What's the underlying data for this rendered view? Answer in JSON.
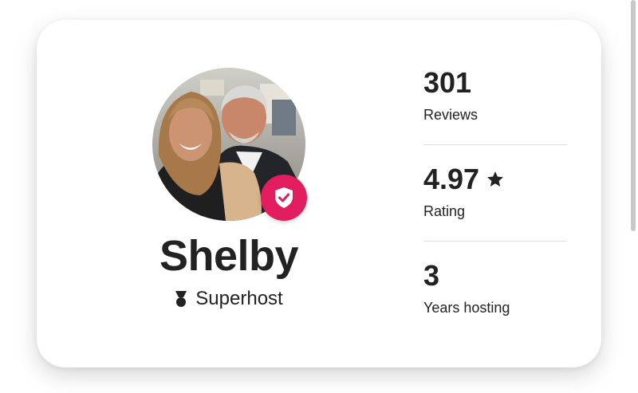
{
  "host": {
    "name": "Shelby",
    "badge_label": "Superhost"
  },
  "stats": {
    "reviews": {
      "value": "301",
      "label": "Reviews"
    },
    "rating": {
      "value": "4.97",
      "label": "Rating"
    },
    "years": {
      "value": "3",
      "label": "Years hosting"
    }
  },
  "icons": {
    "verified": "shield-check-icon",
    "superhost": "superhost-medal-icon",
    "rating": "star-icon"
  },
  "colors": {
    "text": "#222222",
    "accent": "#e11d5f",
    "divider": "#dddddd"
  }
}
